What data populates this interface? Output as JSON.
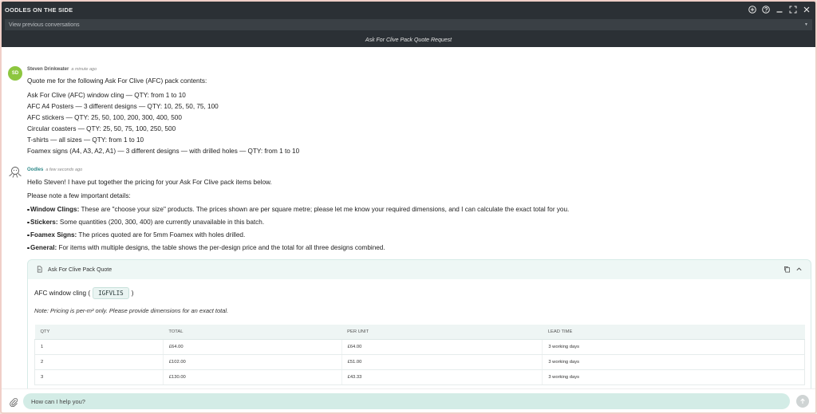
{
  "window": {
    "title": "OODLES ON THE SIDE"
  },
  "conversations": {
    "select_label": "View previous conversations"
  },
  "conversation_title": "Ask For Clive Pack Quote Request",
  "messages": {
    "user": {
      "avatar_initials": "SD",
      "name": "Steven Drinkwater",
      "time": "a minute ago",
      "lines": [
        "Quote me for the following Ask For Clive (AFC) pack contents:",
        "Ask For Clive (AFC) window cling — QTY: from 1 to 10",
        "AFC A4 Posters — 3 different designs — QTY: 10, 25, 50, 75, 100",
        "AFC stickers — QTY: 25, 50, 100, 200, 300, 400, 500",
        "Circular coasters — QTY: 25, 50, 75, 100, 250, 500",
        "T-shirts — all sizes — QTY: from 1 to 10",
        "Foamex signs (A4, A3, A2, A1) — 3 different designs — with drilled holes — QTY: from 1 to 10"
      ]
    },
    "bot": {
      "name": "Oodles",
      "time": "a few seconds ago",
      "greeting": "Hello Steven! I have put together the pricing for your Ask For Clive pack items below.",
      "note_intro": "Please note a few important details:",
      "bullets": [
        {
          "label": "Window Clings:",
          "text": " These are \"choose your size\" products. The prices shown are per square metre; please let me know your required dimensions, and I can calculate the exact total for you."
        },
        {
          "label": "Stickers:",
          "text": " Some quantities (200, 300, 400) are currently unavailable in this batch."
        },
        {
          "label": "Foamex Signs:",
          "text": " The prices quoted are for 5mm Foamex with holes drilled."
        },
        {
          "label": "General:",
          "text": " For items with multiple designs, the table shows the per-design price and the total for all three designs combined."
        }
      ]
    }
  },
  "quote_card": {
    "title": "Ask For Clive Pack Quote",
    "product_prefix": "AFC window cling (",
    "product_code": "IGFVLIS",
    "product_suffix": ")",
    "note": "Note: Pricing is per-m² only. Please provide dimensions for an exact total.",
    "columns": [
      "QTY",
      "TOTAL",
      "PER UNIT",
      "LEAD TIME"
    ],
    "rows": [
      [
        "1",
        "£64.00",
        "£64.00",
        "3 working days"
      ],
      [
        "2",
        "£102.00",
        "£51.00",
        "3 working days"
      ],
      [
        "3",
        "£130.00",
        "£43.33",
        "3 working days"
      ]
    ]
  },
  "input": {
    "placeholder": "How can I help you?"
  },
  "icons": {
    "add": "plus-circle-icon",
    "help": "help-circle-icon",
    "minimize": "minimize-icon",
    "expand": "expand-icon",
    "close": "close-icon",
    "attach": "paperclip-icon",
    "send": "send-arrow-icon",
    "copy": "copy-icon",
    "collapse": "chevron-up-icon",
    "document": "document-icon"
  },
  "colors": {
    "titlebar": "#2b3035",
    "accent": "#2f8a8a",
    "input_bg": "#d3ece6",
    "user_avatar": "#8dc63f"
  }
}
